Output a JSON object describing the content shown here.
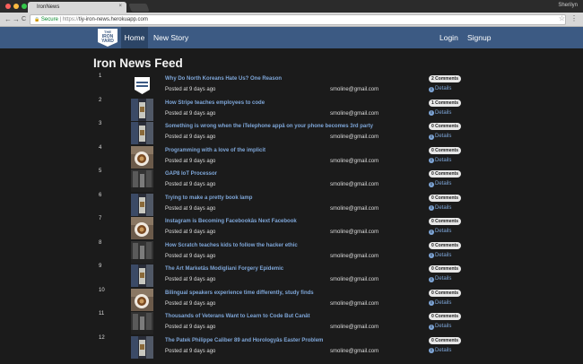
{
  "browser": {
    "tab_title": "IronNews",
    "tab_close": "×",
    "user_name": "Sherilyn",
    "back": "←",
    "forward": "→",
    "reload": "C",
    "lock_glyph": "🔒",
    "secure_label": "Secure",
    "url_scheme": "https://",
    "url_host": "tiy-iron-news.herokuapp.com",
    "star": "☆",
    "menu": "⋮"
  },
  "nav": {
    "logo_line1": "THE",
    "logo_line2": "IRON",
    "logo_line3": "YARD",
    "home": "Home",
    "new_story": "New Story",
    "login": "Login",
    "signup": "Signup"
  },
  "page": {
    "title": "Iron News Feed"
  },
  "stories": [
    {
      "rank": "1",
      "title": "Why Do North Koreans Hate Us? One Reason",
      "posted": "Posted at 9 days ago",
      "email": "smoline@gmail.com",
      "comments": "2 Comments",
      "details": "Details",
      "thumb": "logo"
    },
    {
      "rank": "2",
      "title": "How Stripe teaches employees to code",
      "posted": "Posted at 9 days ago",
      "email": "smoline@gmail.com",
      "comments": "1 Comments",
      "details": "Details",
      "thumb": "hall"
    },
    {
      "rank": "3",
      "title": "Something is wrong when the iTelephone appâ on your phone becomes 3rd party",
      "posted": "Posted at 9 days ago",
      "email": "smoline@gmail.com",
      "comments": "0 Comments",
      "details": "Details",
      "thumb": "hall"
    },
    {
      "rank": "4",
      "title": "Programming with a love of the implicit",
      "posted": "Posted at 9 days ago",
      "email": "smoline@gmail.com",
      "comments": "0 Comments",
      "details": "Details",
      "thumb": "coffee"
    },
    {
      "rank": "5",
      "title": "GAP8 IoT Processor",
      "posted": "Posted at 9 days ago",
      "email": "smoline@gmail.com",
      "comments": "0 Comments",
      "details": "Details",
      "thumb": "street"
    },
    {
      "rank": "6",
      "title": "Trying to make a pretty book lamp",
      "posted": "Posted at 9 days ago",
      "email": "smoline@gmail.com",
      "comments": "0 Comments",
      "details": "Details",
      "thumb": "hall"
    },
    {
      "rank": "7",
      "title": "Instagram is Becoming Facebookâs Next Facebook",
      "posted": "Posted at 9 days ago",
      "email": "smoline@gmail.com",
      "comments": "0 Comments",
      "details": "Details",
      "thumb": "coffee"
    },
    {
      "rank": "8",
      "title": "How Scratch teaches kids to follow the hacker ethic",
      "posted": "Posted at 9 days ago",
      "email": "smoline@gmail.com",
      "comments": "0 Comments",
      "details": "Details",
      "thumb": "street"
    },
    {
      "rank": "9",
      "title": "The Art Marketâs Modigliani Forgery Epidemic",
      "posted": "Posted at 9 days ago",
      "email": "smoline@gmail.com",
      "comments": "0 Comments",
      "details": "Details",
      "thumb": "hall"
    },
    {
      "rank": "10",
      "title": "Bilingual speakers experience time differently, study finds",
      "posted": "Posted at 9 days ago",
      "email": "smoline@gmail.com",
      "comments": "0 Comments",
      "details": "Details",
      "thumb": "coffee"
    },
    {
      "rank": "11",
      "title": "Thousands of Veterans Want to Learn to Code But Canât",
      "posted": "Posted at 9 days ago",
      "email": "smoline@gmail.com",
      "comments": "0 Comments",
      "details": "Details",
      "thumb": "street"
    },
    {
      "rank": "12",
      "title": "The Patek Philippe Caliber 89 and Horologyâs Easter Problem",
      "posted": "Posted at 9 days ago",
      "email": "smoline@gmail.com",
      "comments": "0 Comments",
      "details": "Details",
      "thumb": "hall"
    }
  ],
  "colors": {
    "nav_bg": "#3c5a83",
    "link": "#7ea6d8",
    "background": "#1b1b1b"
  }
}
